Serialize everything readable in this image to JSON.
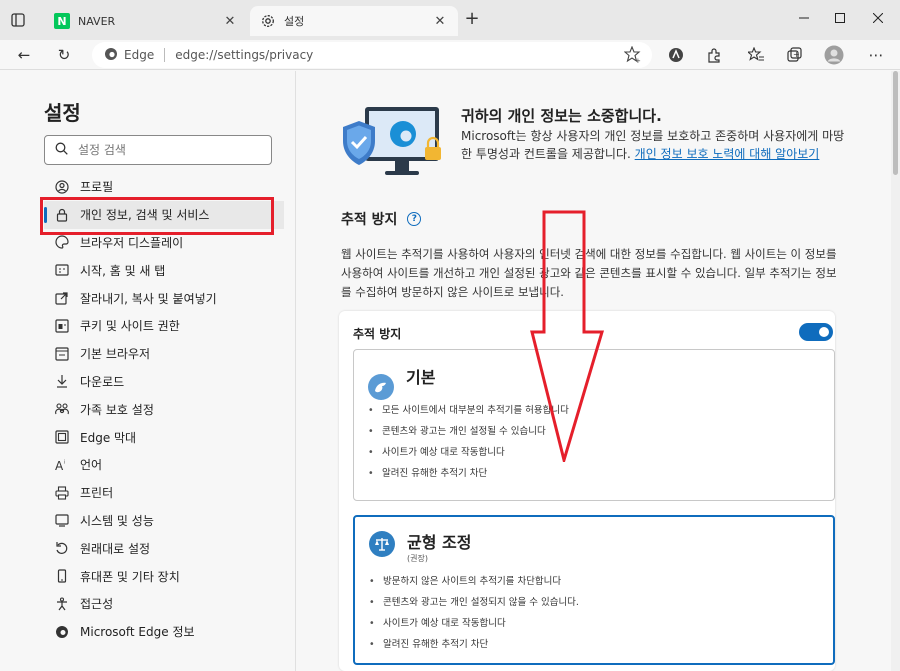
{
  "tabs": [
    {
      "title": "NAVER",
      "favicon": "naver-icon",
      "favicon_letter": "N",
      "active": false
    },
    {
      "title": "설정",
      "favicon": "gear-icon",
      "active": true
    }
  ],
  "toolbar": {
    "address_label": "Edge",
    "address_url": "edge://settings/privacy"
  },
  "sidebar": {
    "title": "설정",
    "search_placeholder": "설정 검색",
    "items": [
      {
        "label": "프로필",
        "icon": "profile-icon"
      },
      {
        "label": "개인 정보, 검색 및 서비스",
        "icon": "lock-icon",
        "active": true
      },
      {
        "label": "브라우저 디스플레이",
        "icon": "palette-icon"
      },
      {
        "label": "시작, 홈 및 새 탭",
        "icon": "home-grid-icon"
      },
      {
        "label": "잘라내기, 복사 및 붙여넣기",
        "icon": "share-icon"
      },
      {
        "label": "쿠키 및 사이트 권한",
        "icon": "cookie-site-icon"
      },
      {
        "label": "기본 브라우저",
        "icon": "browser-icon"
      },
      {
        "label": "다운로드",
        "icon": "download-icon"
      },
      {
        "label": "가족 보호 설정",
        "icon": "family-icon"
      },
      {
        "label": "Edge 막대",
        "icon": "edge-bar-icon"
      },
      {
        "label": "언어",
        "icon": "language-icon"
      },
      {
        "label": "프린터",
        "icon": "printer-icon"
      },
      {
        "label": "시스템 및 성능",
        "icon": "system-icon"
      },
      {
        "label": "원래대로 설정",
        "icon": "reset-icon"
      },
      {
        "label": "휴대폰 및 기타 장치",
        "icon": "phone-icon"
      },
      {
        "label": "접근성",
        "icon": "accessibility-icon"
      },
      {
        "label": "Microsoft Edge 정보",
        "icon": "edge-logo-icon"
      }
    ]
  },
  "hero": {
    "title": "귀하의 개인 정보는 소중합니다.",
    "desc": "Microsoft는 항상 사용자의 개인 정보를 보호하고 존중하며 사용자에게 마땅한 투명성과 컨트롤을 제공합니다.",
    "link": "개인 정보 보호 노력에 대해 알아보기"
  },
  "tracking": {
    "section_title": "추적 방지",
    "desc": "웹 사이트는 추적기를 사용하여 사용자의 인터넷 검색에 대한 정보를 수집합니다. 웹 사이트는 이 정보를 사용하여 사이트를 개선하고 개인 설정된 광고와 같은 콘텐츠를 표시할 수 있습니다. 일부 추적기는 정보를 수집하여 방문하지 않은 사이트로 보냅니다.",
    "card_label": "추적 방지",
    "toggle_on": true,
    "options": {
      "basic": {
        "title": "기본",
        "items": [
          "모든 사이트에서 대부분의 추적기를 허용합니다",
          "콘텐츠와 광고는 개인 설정될 수 있습니다",
          "사이트가 예상 대로 작동합니다",
          "알려진 유해한 추적기 차단"
        ]
      },
      "balanced": {
        "title": "균형 조정",
        "subtitle": "(권장)",
        "items": [
          "방문하지 않은 사이트의 추적기를 차단합니다",
          "콘텐츠와 광고는 개인 설정되지 않을 수 있습니다.",
          "사이트가 예상 대로 작동합니다",
          "알려진 유해한 추적기 차단"
        ]
      }
    }
  },
  "colors": {
    "accent": "#0f6cbd",
    "annotation_red": "#e51f2b"
  }
}
